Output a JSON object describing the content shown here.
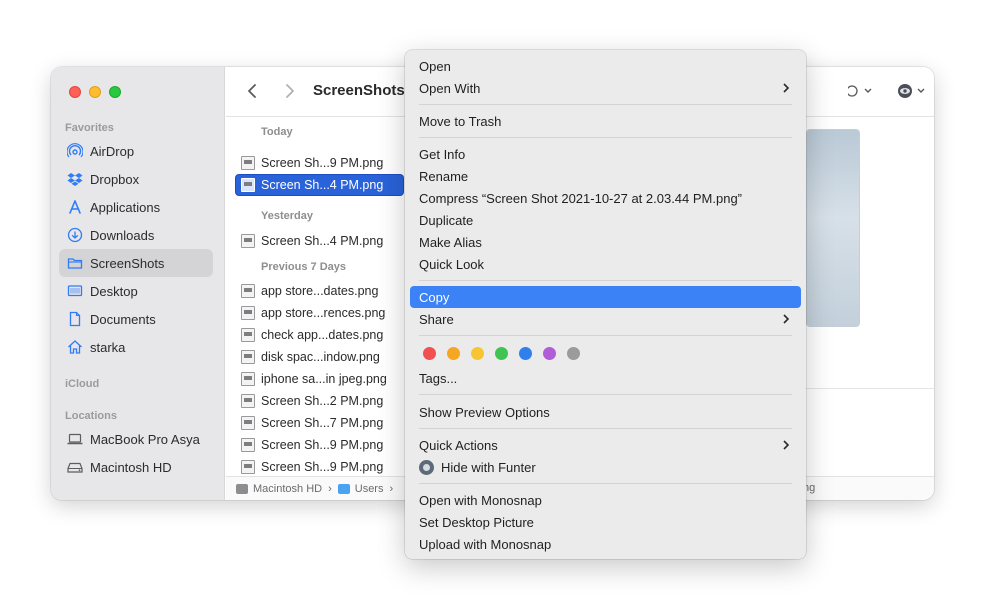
{
  "window": {
    "title": "ScreenShots"
  },
  "sidebar": {
    "favorites_header": "Favorites",
    "icloud_header": "iCloud",
    "locations_header": "Locations",
    "favorites": [
      {
        "label": "AirDrop",
        "icon": "airdrop-icon"
      },
      {
        "label": "Dropbox",
        "icon": "dropbox-icon"
      },
      {
        "label": "Applications",
        "icon": "applications-icon"
      },
      {
        "label": "Downloads",
        "icon": "downloads-icon"
      },
      {
        "label": "ScreenShots",
        "icon": "folder-icon",
        "selected": true
      },
      {
        "label": "Desktop",
        "icon": "desktop-icon"
      },
      {
        "label": "Documents",
        "icon": "document-icon"
      },
      {
        "label": "starka",
        "icon": "home-icon"
      }
    ],
    "locations": [
      {
        "label": "MacBook Pro Asya",
        "icon": "laptop-icon"
      },
      {
        "label": "Macintosh HD",
        "icon": "disk-icon"
      }
    ]
  },
  "files": {
    "groups": [
      {
        "header": "Today",
        "items": [
          "Screen Sh...9 PM.png",
          "Screen Sh...4 PM.png"
        ]
      },
      {
        "header": "Yesterday",
        "items": [
          "Screen Sh...4 PM.png"
        ]
      },
      {
        "header": "Previous 7 Days",
        "items": [
          "app store...dates.png",
          "app store...rences.png",
          "check app...dates.png",
          "disk spac...indow.png",
          "iphone sa...in jpeg.png",
          "Screen Sh...2 PM.png",
          "Screen Sh...7 PM.png",
          "Screen Sh...9 PM.png",
          "Screen Sh...9 PM.png"
        ]
      }
    ],
    "selected": "Screen Sh...4 PM.png"
  },
  "pathbar": {
    "segments": [
      "Macintosh HD",
      "Users"
    ],
    "tail": "ng"
  },
  "context_menu": {
    "open": "Open",
    "open_with": "Open With",
    "move_to_trash": "Move to Trash",
    "get_info": "Get Info",
    "rename": "Rename",
    "compress": "Compress “Screen Shot 2021-10-27 at 2.03.44 PM.png”",
    "duplicate": "Duplicate",
    "make_alias": "Make Alias",
    "quick_look": "Quick Look",
    "copy": "Copy",
    "share": "Share",
    "tags": "Tags...",
    "show_preview_options": "Show Preview Options",
    "quick_actions": "Quick Actions",
    "hide_with_funter": "Hide with Funter",
    "open_with_monosnap": "Open with Monosnap",
    "set_desktop_picture": "Set Desktop Picture",
    "upload_with_monosnap": "Upload with Monosnap",
    "tag_colors": [
      "#f0504f",
      "#f5a623",
      "#f7c531",
      "#3fc451",
      "#2f80ed",
      "#b15dd8",
      "#9b9b9b"
    ]
  }
}
